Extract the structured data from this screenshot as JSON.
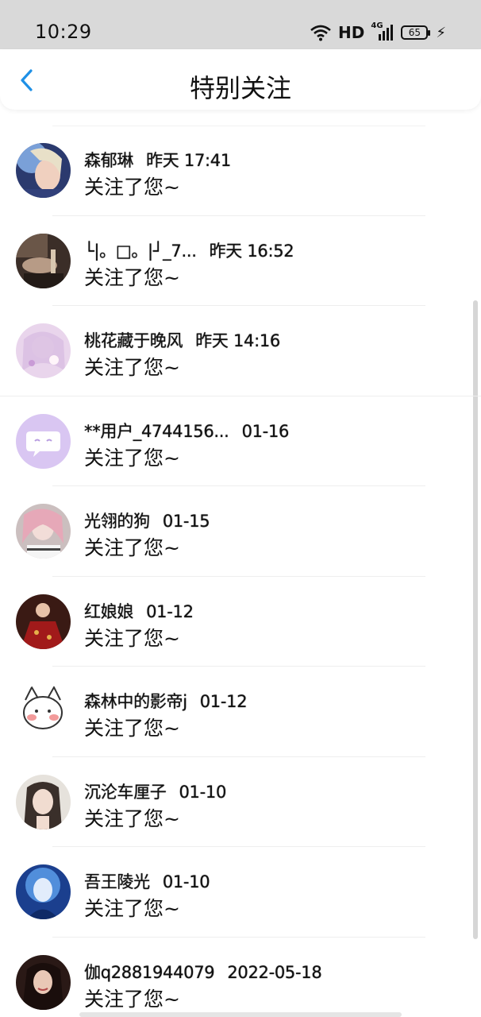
{
  "status_bar": {
    "time": "10:29",
    "network": "HD",
    "cellular": "4G",
    "battery": "65"
  },
  "header": {
    "title": "特别关注"
  },
  "items": [
    {
      "name": "森郁琳",
      "time": "昨天 17:41",
      "message": "关注了您~"
    },
    {
      "name": "└|。□。|┘_7...",
      "time": "昨天 16:52",
      "message": "关注了您~"
    },
    {
      "name": "桃花藏于晚风",
      "time": "昨天 14:16",
      "message": "关注了您~"
    },
    {
      "name": "**用户_4744156...",
      "time": "01-16",
      "message": "关注了您~"
    },
    {
      "name": "光翎的狗",
      "time": "01-15",
      "message": "关注了您~"
    },
    {
      "name": "红娘娘",
      "time": "01-12",
      "message": "关注了您~"
    },
    {
      "name": "森林中的影帝j",
      "time": "01-12",
      "message": "关注了您~"
    },
    {
      "name": "沉沦车厘子",
      "time": "01-10",
      "message": "关注了您~"
    },
    {
      "name": "吾王陵光",
      "time": "01-10",
      "message": "关注了您~"
    },
    {
      "name": "伽q2881944079",
      "time": "2022-05-18",
      "message": "关注了您~"
    }
  ],
  "colors": {
    "accent": "#1e90e6",
    "status_bar_bg": "#d9d9d9",
    "divider": "#eeeeee"
  }
}
